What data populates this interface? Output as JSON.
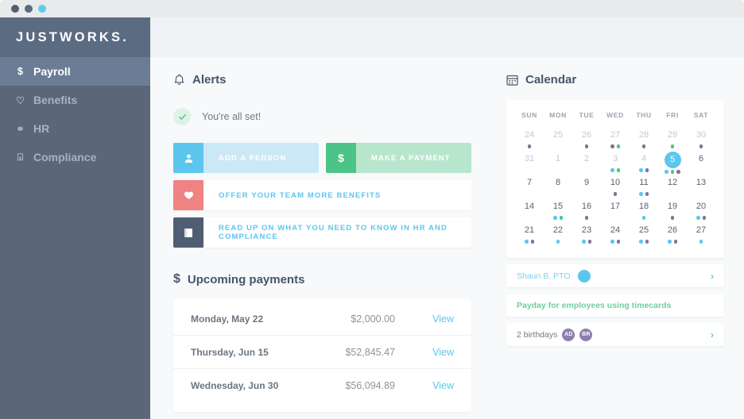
{
  "window": {
    "dots": [
      "#545f70",
      "#5b6b82",
      "#5ccdf0"
    ]
  },
  "sidebar": {
    "brand": "JUSTWORKS.",
    "items": [
      {
        "label": "Payroll",
        "icon": "dollar-icon",
        "glyph": "$",
        "active": true
      },
      {
        "label": "Benefits",
        "icon": "heart-icon",
        "glyph": "♡",
        "active": false
      },
      {
        "label": "HR",
        "icon": "people-icon",
        "glyph": "⚭",
        "active": false
      },
      {
        "label": "Compliance",
        "icon": "briefcase-icon",
        "glyph": "⌺",
        "active": false
      }
    ]
  },
  "alerts": {
    "title": "Alerts",
    "icon": "bell-icon",
    "status_text": "You're all set!",
    "status_icon": "check-circle-icon",
    "primary_actions": [
      {
        "label": "ADD A PERSON",
        "icon": "person-icon",
        "glyph": "♟",
        "style": "blue"
      },
      {
        "label": "MAKE A PAYMENT",
        "icon": "dollar-icon",
        "glyph": "$",
        "style": "green"
      }
    ],
    "list_actions": [
      {
        "label": "OFFER YOUR TEAM MORE BENEFITS",
        "icon": "heart-icon",
        "glyph": "♥",
        "style": "red"
      },
      {
        "label": "READ UP ON WHAT YOU NEED TO KNOW IN HR AND COMPLIANCE",
        "icon": "book-icon",
        "glyph": "■",
        "style": "dark"
      }
    ]
  },
  "payments": {
    "title": "Upcoming payments",
    "icon": "dollar-icon",
    "rows": [
      {
        "date": "Monday, May 22",
        "amount": "$2,000.00",
        "action": "View"
      },
      {
        "date": "Thursday, Jun 15",
        "amount": "$52,845.47",
        "action": "View"
      },
      {
        "date": "Wednesday, Jun 30",
        "amount": "$56,094.89",
        "action": "View"
      }
    ]
  },
  "calendar": {
    "title": "Calendar",
    "icon": "calendar-icon",
    "dow": [
      "SUN",
      "MON",
      "TUE",
      "WED",
      "THU",
      "FRI",
      "SAT"
    ],
    "colors": {
      "blue": "#5cc6ef",
      "green": "#4cc487",
      "purple": "#7f7498",
      "today": "#5cc6ef"
    },
    "weeks": [
      [
        {
          "n": "24",
          "muted": true,
          "dots": [
            "purple"
          ]
        },
        {
          "n": "25",
          "muted": true,
          "dots": []
        },
        {
          "n": "26",
          "muted": true,
          "dots": [
            "purple"
          ]
        },
        {
          "n": "27",
          "muted": true,
          "dots": [
            "purple",
            "green"
          ]
        },
        {
          "n": "28",
          "muted": true,
          "dots": [
            "purple"
          ]
        },
        {
          "n": "29",
          "muted": true,
          "dots": [
            "green"
          ]
        },
        {
          "n": "30",
          "muted": true,
          "dots": [
            "purple"
          ]
        }
      ],
      [
        {
          "n": "31",
          "muted": true,
          "dots": []
        },
        {
          "n": "1",
          "muted": true,
          "dots": []
        },
        {
          "n": "2",
          "muted": true,
          "dots": []
        },
        {
          "n": "3",
          "muted": true,
          "dots": [
            "blue",
            "green"
          ]
        },
        {
          "n": "4",
          "muted": true,
          "dots": [
            "blue",
            "purple"
          ]
        },
        {
          "n": "5",
          "muted": false,
          "today": true,
          "dots": [
            "blue",
            "green",
            "purple"
          ]
        },
        {
          "n": "6",
          "muted": false,
          "dots": []
        }
      ],
      [
        {
          "n": "7",
          "muted": false,
          "dots": []
        },
        {
          "n": "8",
          "muted": false,
          "dots": []
        },
        {
          "n": "9",
          "muted": false,
          "dots": []
        },
        {
          "n": "10",
          "muted": false,
          "dots": [
            "purple"
          ]
        },
        {
          "n": "11",
          "muted": false,
          "dots": [
            "blue",
            "purple"
          ]
        },
        {
          "n": "12",
          "muted": false,
          "dots": []
        },
        {
          "n": "13",
          "muted": false,
          "dots": []
        }
      ],
      [
        {
          "n": "14",
          "muted": false,
          "dots": []
        },
        {
          "n": "15",
          "muted": false,
          "dots": [
            "blue",
            "green"
          ]
        },
        {
          "n": "16",
          "muted": false,
          "dots": [
            "purple"
          ]
        },
        {
          "n": "17",
          "muted": false,
          "dots": []
        },
        {
          "n": "18",
          "muted": false,
          "dots": [
            "blue"
          ]
        },
        {
          "n": "19",
          "muted": false,
          "dots": [
            "purple"
          ]
        },
        {
          "n": "20",
          "muted": false,
          "dots": [
            "blue",
            "purple"
          ]
        }
      ],
      [
        {
          "n": "21",
          "muted": false,
          "dots": [
            "blue",
            "purple"
          ]
        },
        {
          "n": "22",
          "muted": false,
          "dots": [
            "blue"
          ]
        },
        {
          "n": "23",
          "muted": false,
          "dots": [
            "blue",
            "purple"
          ]
        },
        {
          "n": "24",
          "muted": false,
          "dots": [
            "blue",
            "purple"
          ]
        },
        {
          "n": "25",
          "muted": false,
          "dots": [
            "blue",
            "purple"
          ]
        },
        {
          "n": "26",
          "muted": false,
          "dots": [
            "blue",
            "purple"
          ]
        },
        {
          "n": "27",
          "muted": false,
          "dots": [
            "blue"
          ]
        }
      ]
    ],
    "events": [
      {
        "label": "Shaun B. PTO",
        "style": "blue",
        "avatars": [
          {
            "type": "blank",
            "color": "#5cc6ef"
          }
        ],
        "chevron": "›"
      },
      {
        "label": "Payday for employees using timecards",
        "style": "green",
        "avatars": [],
        "chevron": ""
      },
      {
        "label": "2 birthdays",
        "style": "grey",
        "avatars": [
          {
            "type": "initials",
            "text": "AD"
          },
          {
            "type": "initials",
            "text": "BR"
          }
        ],
        "chevron": "›"
      }
    ]
  }
}
